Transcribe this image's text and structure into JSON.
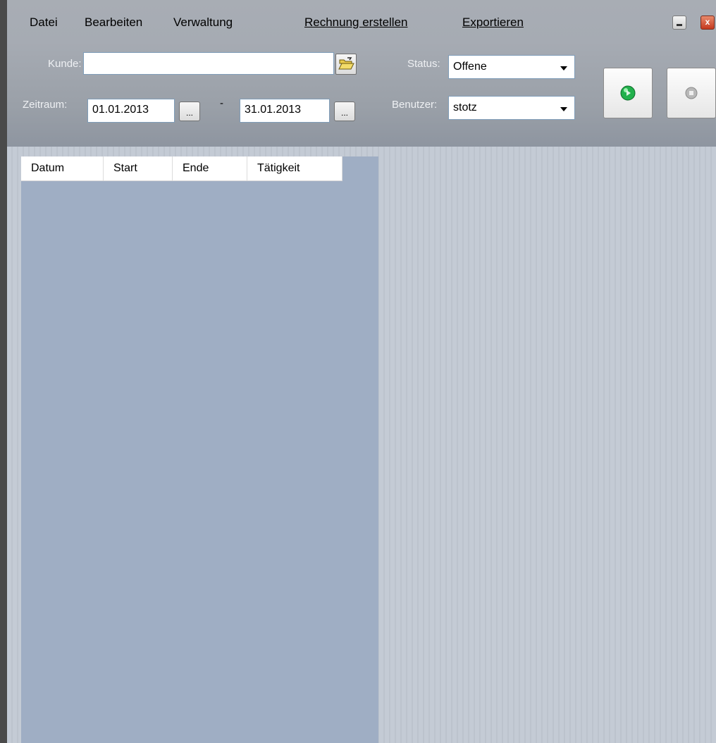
{
  "menu": {
    "datei": "Datei",
    "bearbeiten": "Bearbeiten",
    "verwaltung": "Verwaltung",
    "rechnung": "Rechnung erstellen",
    "exportieren": "Exportieren"
  },
  "window_controls": {
    "close_glyph": "x"
  },
  "filters": {
    "kunde_label": "Kunde:",
    "kunde_value": "",
    "zeitraum_label": "Zeitraum:",
    "date_from": "01.01.2013",
    "date_to": "31.01.2013",
    "date_separator": "-",
    "picker_label": "...",
    "status_label": "Status:",
    "status_value": "Offene",
    "benutzer_label": "Benutzer:",
    "benutzer_value": "stotz"
  },
  "icons": {
    "folder": "folder-open-icon",
    "start": "green-play-icon",
    "stop": "gray-stop-icon"
  },
  "list": {
    "columns": [
      "Datum",
      "Start",
      "Ende",
      "Tätigkeit"
    ],
    "rows": []
  },
  "colors": {
    "accent_green": "#22b14c",
    "panel_bg": "#9faec4"
  }
}
